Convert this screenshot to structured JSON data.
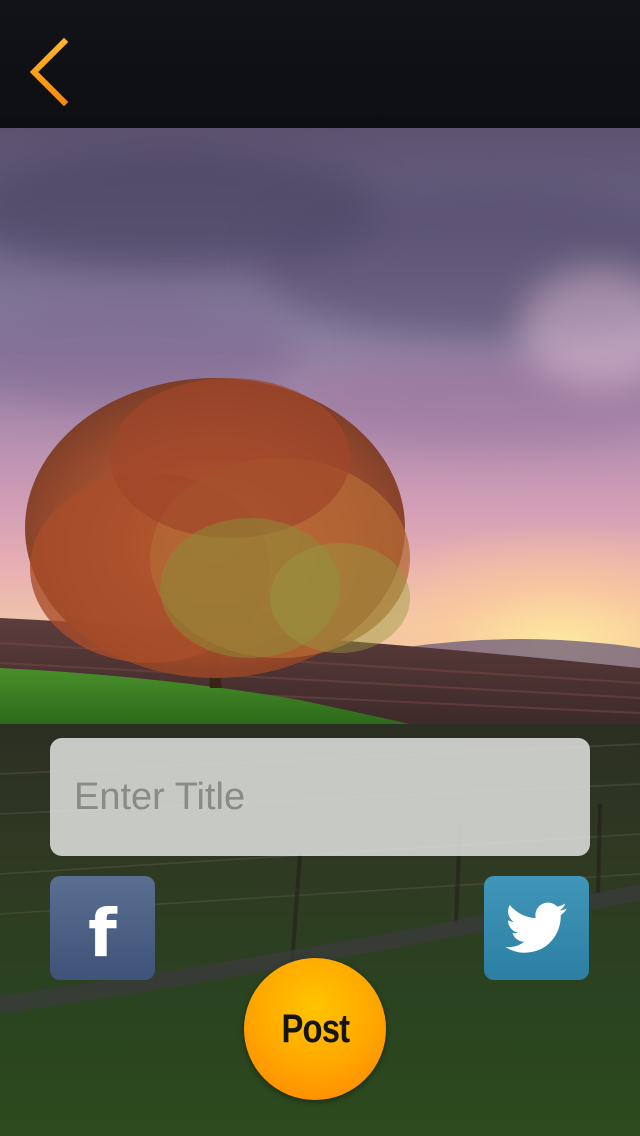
{
  "nav": {
    "back_icon": "chevron-left-icon",
    "accent_color": "#f7a21b"
  },
  "photo": {
    "description": ""
  },
  "form": {
    "title_placeholder": "Enter Title",
    "title_value": ""
  },
  "share": {
    "facebook_icon": "facebook-icon",
    "facebook_glyph": "f",
    "facebook_color": "#4a5f85",
    "twitter_icon": "twitter-bird-icon",
    "twitter_color": "#3589ad"
  },
  "actions": {
    "post_label": "Post",
    "post_color": "#ff9800"
  }
}
